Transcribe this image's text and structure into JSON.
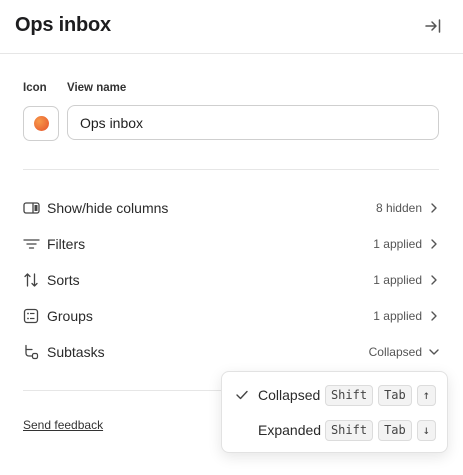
{
  "header": {
    "title": "Ops inbox",
    "collapse_icon": "collapse-right-icon"
  },
  "form": {
    "icon_label": "Icon",
    "view_name_label": "View name",
    "icon_color": "#ee6b33",
    "view_name_value": "Ops inbox"
  },
  "menu": [
    {
      "label": "Show/hide columns",
      "value": "8 hidden",
      "icon": "columns-icon"
    },
    {
      "label": "Filters",
      "value": "1 applied",
      "icon": "filter-icon"
    },
    {
      "label": "Sorts",
      "value": "1 applied",
      "icon": "sort-icon"
    },
    {
      "label": "Groups",
      "value": "1 applied",
      "icon": "groups-icon"
    },
    {
      "label": "Subtasks",
      "value": "Collapsed",
      "icon": "subtasks-icon",
      "expanded": true
    }
  ],
  "footer": {
    "feedback_label": "Send feedback"
  },
  "dropdown": {
    "options": [
      {
        "label": "Collapsed",
        "selected": true,
        "keys": [
          "Shift",
          "Tab",
          "↑"
        ]
      },
      {
        "label": "Expanded",
        "selected": false,
        "keys": [
          "Shift",
          "Tab",
          "↓"
        ]
      }
    ]
  }
}
